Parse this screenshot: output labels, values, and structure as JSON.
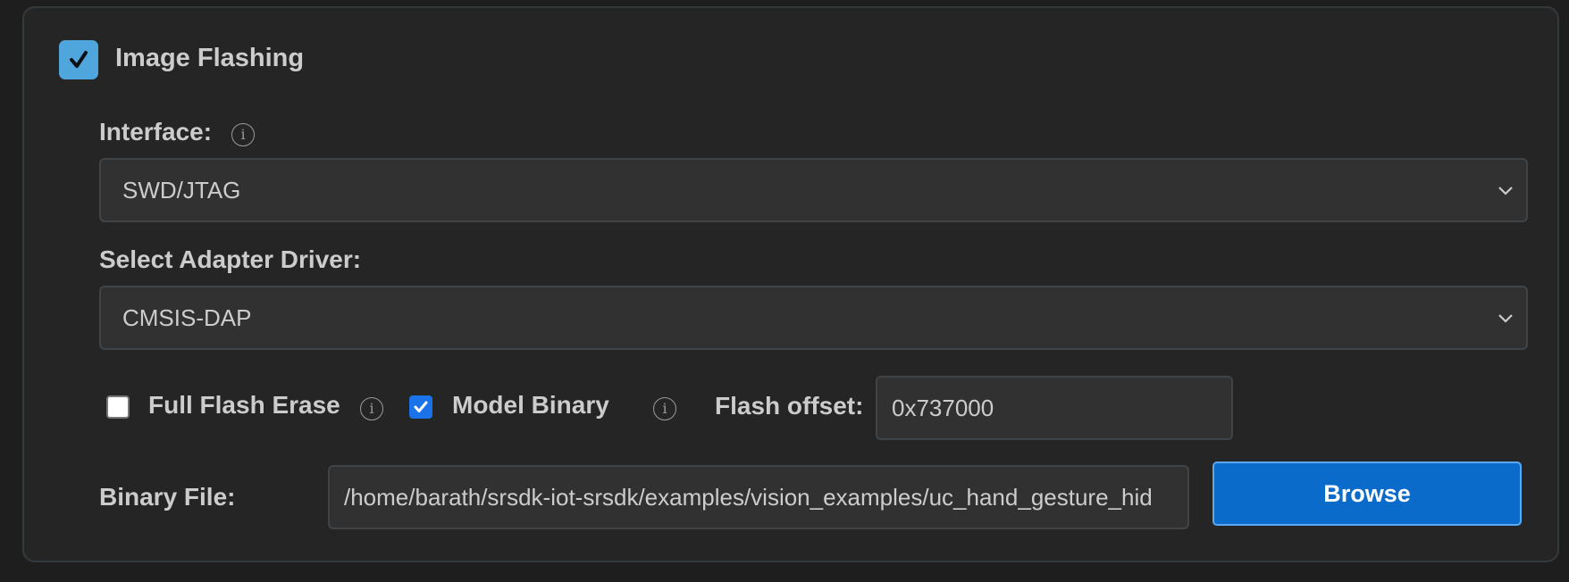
{
  "section": {
    "title": "Image Flashing",
    "enabled": true
  },
  "interface": {
    "label": "Interface:",
    "info_icon": "info-icon",
    "selected": "SWD/JTAG"
  },
  "adapter": {
    "label": "Select Adapter Driver:",
    "selected": "CMSIS-DAP"
  },
  "options": {
    "full_flash_erase": {
      "label": "Full Flash Erase",
      "checked": false,
      "info_icon": "info-icon"
    },
    "model_binary": {
      "label": "Model Binary",
      "checked": true,
      "info_icon": "info-icon"
    },
    "flash_offset": {
      "label": "Flash offset:",
      "value": "0x737000"
    }
  },
  "binary_file": {
    "label": "Binary File:",
    "value": "/home/barath/srsdk-iot-srsdk/examples/vision_examples/uc_hand_gesture_hid",
    "browse_label": "Browse"
  },
  "colors": {
    "background": "#1e1e1e",
    "panel": "#252526",
    "accent_checkbox": "#4ea6dc",
    "button": "#0b6bcb"
  }
}
